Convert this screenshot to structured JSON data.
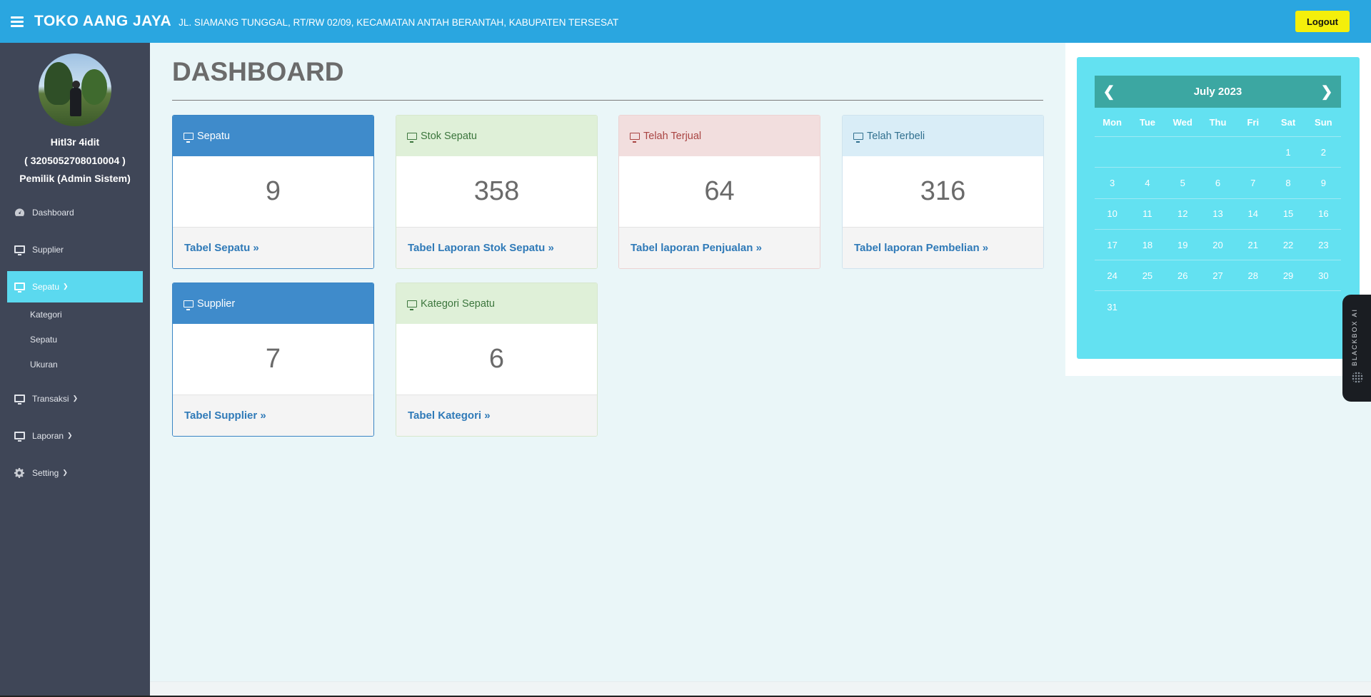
{
  "header": {
    "brand": "TOKO AANG JAYA",
    "address": "JL. SIAMANG TUNGGAL, RT/RW 02/09, KECAMATAN ANTAH BERANTAH, KABUPATEN TERSESAT",
    "logout_label": "Logout"
  },
  "sidebar": {
    "user_name": "Hitl3r 4idit",
    "user_id": "( 3205052708010004 )",
    "user_role": "Pemilik (Admin Sistem)",
    "items": [
      {
        "label": "Dashboard",
        "icon": "dashboard-icon"
      },
      {
        "label": "Supplier",
        "icon": "monitor-icon"
      },
      {
        "label": "Sepatu",
        "icon": "monitor-icon"
      },
      {
        "label": "Transaksi",
        "icon": "monitor-icon"
      },
      {
        "label": "Laporan",
        "icon": "monitor-icon"
      },
      {
        "label": "Setting",
        "icon": "gear-icon"
      }
    ],
    "submenu": [
      "Kategori",
      "Sepatu",
      "Ukuran"
    ]
  },
  "main": {
    "title": "DASHBOARD",
    "cards": [
      {
        "title": "Sepatu",
        "value": "9",
        "link": "Tabel Sepatu"
      },
      {
        "title": "Stok Sepatu",
        "value": "358",
        "link": "Tabel Laporan Stok Sepatu"
      },
      {
        "title": "Telah Terjual",
        "value": "64",
        "link": "Tabel laporan Penjualan"
      },
      {
        "title": "Telah Terbeli",
        "value": "316",
        "link": "Tabel laporan Pembelian"
      },
      {
        "title": "Supplier",
        "value": "7",
        "link": "Tabel Supplier"
      },
      {
        "title": "Kategori Sepatu",
        "value": "6",
        "link": "Tabel Kategori"
      }
    ]
  },
  "calendar": {
    "month_label": "July 2023",
    "weekdays": [
      "Mon",
      "Tue",
      "Wed",
      "Thu",
      "Fri",
      "Sat",
      "Sun"
    ],
    "weeks": [
      [
        "",
        "",
        "",
        "",
        "",
        "1",
        "2"
      ],
      [
        "3",
        "4",
        "5",
        "6",
        "7",
        "8",
        "9"
      ],
      [
        "10",
        "11",
        "12",
        "13",
        "14",
        "15",
        "16"
      ],
      [
        "17",
        "18",
        "19",
        "20",
        "21",
        "22",
        "23"
      ],
      [
        "24",
        "25",
        "26",
        "27",
        "28",
        "29",
        "30"
      ],
      [
        "31",
        "",
        "",
        "",
        "",
        "",
        ""
      ]
    ]
  },
  "widget": {
    "label": "BLACKBOX AI"
  },
  "colors": {
    "topbar": "#2aa6e0",
    "sidebar": "#3f4657",
    "active_nav": "#5bd9ef",
    "logout": "#f4ef0b",
    "calendar_bg": "#63e1f1",
    "calendar_header": "#3ca7a2"
  }
}
